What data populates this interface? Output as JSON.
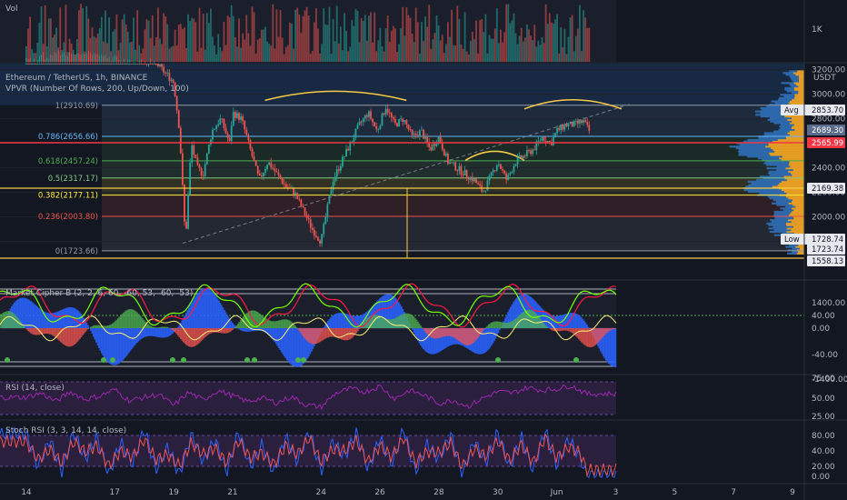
{
  "chart_data": {
    "type": "line",
    "panes": {
      "volume": {
        "title": "Vol",
        "tick": "1K"
      },
      "price": {
        "title": "Ethereum / TetherUS, 1h, BINANCE",
        "indicator": "VPVR (Number Of Rows, 200, Up/Down, 100)",
        "unit": "USDT",
        "ylim": [
          1500,
          3250
        ],
        "ticks": [
          "3200.00",
          "3000.00",
          "2800.00",
          "2600.00",
          "2400.00",
          "2200.00",
          "2000.00",
          "1800.00"
        ],
        "avg_label": "Avg",
        "avg_price": "2853.70",
        "low_label": "Low",
        "low_price": "1728.74",
        "current_prices": [
          "2689.30",
          "2565.99"
        ],
        "price_tags": [
          "2169.38",
          "1723.74",
          "1558.13"
        ],
        "fib_levels": [
          {
            "label": "1(2910.69)",
            "price": 2910.69,
            "color": "#9598a1"
          },
          {
            "label": "0.786(2656.66)",
            "price": 2656.66,
            "color": "#64b5f6"
          },
          {
            "label": "0.618(2457.24)",
            "price": 2457.24,
            "color": "#4caf50"
          },
          {
            "label": "0.5(2317.17)",
            "price": 2317.17,
            "color": "#81c784"
          },
          {
            "label": "0.382(2177.11)",
            "price": 2177.11,
            "color": "#ffeb3b"
          },
          {
            "label": "0.236(2003.80)",
            "price": 2003.8,
            "color": "#ef5350"
          },
          {
            "label": "0(1723.66)",
            "price": 1723.66,
            "color": "#9598a1"
          }
        ],
        "series": [
          {
            "name": "close",
            "x": [
              14,
              15,
              16,
              17,
              17.7,
              18.3,
              19,
              19.2,
              19.4,
              19.6,
              19.8,
              20,
              20.3,
              20.6,
              20.9,
              21,
              21.3,
              21.6,
              21.9,
              22.2,
              22.5,
              22.8,
              23.1,
              23.4,
              23.7,
              24,
              24.2,
              24.4,
              24.7,
              25,
              25.3,
              25.6,
              25.9,
              26.2,
              26.5,
              26.8,
              27.1,
              27.4,
              27.7,
              28,
              28.3,
              28.6,
              28.9,
              29.2,
              29.5,
              29.8,
              30,
              30.3,
              30.6,
              30.9,
              31.2,
              31.5,
              31.8,
              32,
              32.3,
              32.6,
              32.9,
              33.1
            ],
            "y": [
              3300,
              3350,
              3380,
              3320,
              3300,
              3280,
              3100,
              2700,
              1800,
              2600,
              2400,
              2350,
              2700,
              2800,
              2600,
              2850,
              2800,
              2550,
              2300,
              2450,
              2350,
              2250,
              2200,
              2050,
              1900,
              1800,
              2050,
              2300,
              2450,
              2600,
              2750,
              2850,
              2700,
              2900,
              2750,
              2800,
              2650,
              2700,
              2550,
              2650,
              2450,
              2400,
              2350,
              2300,
              2200,
              2350,
              2450,
              2300,
              2450,
              2500,
              2550,
              2650,
              2600,
              2700,
              2750,
              2750,
              2780,
              2700
            ]
          }
        ],
        "trendline": {
          "x": [
            19.3,
            34.5
          ],
          "y": [
            1785,
            2920
          ]
        }
      },
      "market_cipher": {
        "title": "Market Cipher B (2, 2, 6, 60, -60, 53, -60, -53)",
        "ylim": [
          -75,
          75
        ],
        "ticks": [
          "1400.00",
          "40.00",
          "0.00",
          "-40.00",
          "-1400.00"
        ]
      },
      "rsi": {
        "title": "RSI (14, close)",
        "ylim": [
          20,
          80
        ],
        "ticks": [
          "75.00",
          "50.00",
          "25.00"
        ],
        "x": [
          14,
          14.5,
          15,
          15.5,
          16,
          16.5,
          17,
          17.5,
          18,
          18.5,
          19,
          19.5,
          20,
          20.5,
          21,
          21.5,
          22,
          22.5,
          23,
          23.5,
          24,
          24.5,
          25,
          25.5,
          26,
          26.5,
          27,
          27.5,
          28,
          28.5,
          29,
          29.5,
          30,
          30.5,
          31,
          31.5,
          32,
          32.5,
          33
        ],
        "values": [
          50,
          56,
          44,
          58,
          47,
          52,
          61,
          45,
          50,
          54,
          38,
          57,
          46,
          60,
          52,
          44,
          49,
          42,
          51,
          39,
          36,
          56,
          62,
          58,
          66,
          48,
          60,
          53,
          41,
          46,
          37,
          49,
          58,
          56,
          64,
          60,
          62,
          67,
          55
        ]
      },
      "stoch_rsi": {
        "title": "Stoch RSI (3, 3, 14, 14, close)",
        "ylim": [
          -5,
          105
        ],
        "ticks": [
          "80.00",
          "40.00",
          "20.00",
          "0.00"
        ],
        "series": [
          {
            "name": "K",
            "x": [
              14,
              14.4,
              14.8,
              15.2,
              15.6,
              16,
              16.4,
              16.8,
              17.2,
              17.6,
              18,
              18.4,
              18.8,
              19.2,
              19.6,
              20,
              20.4,
              20.8,
              21.2,
              21.6,
              22,
              22.4,
              22.8,
              23.2,
              23.6,
              24,
              24.4,
              24.8,
              25.2,
              25.6,
              26,
              26.4,
              26.8,
              27.2,
              27.6,
              28,
              28.4,
              28.8,
              29.2,
              29.6,
              30,
              30.4,
              30.8,
              31.2,
              31.6,
              32,
              32.4,
              32.8,
              33
            ],
            "values": [
              85,
              20,
              75,
              10,
              90,
              35,
              80,
              5,
              70,
              25,
              95,
              15,
              60,
              5,
              85,
              30,
              75,
              10,
              90,
              20,
              65,
              8,
              80,
              30,
              92,
              12,
              70,
              40,
              88,
              15,
              78,
              25,
              95,
              10,
              65,
              35,
              85,
              5,
              72,
              28,
              90,
              18,
              80,
              12,
              94,
              22,
              76,
              38,
              5
            ]
          },
          {
            "name": "D",
            "x": [
              14,
              14.4,
              14.8,
              15.2,
              15.6,
              16,
              16.4,
              16.8,
              17.2,
              17.6,
              18,
              18.4,
              18.8,
              19.2,
              19.6,
              20,
              20.4,
              20.8,
              21.2,
              21.6,
              22,
              22.4,
              22.8,
              23.2,
              23.6,
              24,
              24.4,
              24.8,
              25.2,
              25.6,
              26,
              26.4,
              26.8,
              27.2,
              27.6,
              28,
              28.4,
              28.8,
              29.2,
              29.6,
              30,
              30.4,
              30.8,
              31.2,
              31.6,
              32,
              32.4,
              32.8,
              33
            ],
            "values": [
              70,
              35,
              55,
              28,
              70,
              50,
              62,
              22,
              52,
              40,
              75,
              35,
              45,
              22,
              68,
              45,
              58,
              28,
              72,
              38,
              48,
              25,
              62,
              45,
              78,
              30,
              55,
              52,
              72,
              30,
              62,
              40,
              78,
              28,
              50,
              48,
              68,
              20,
              56,
              42,
              72,
              32,
              65,
              28,
              78,
              38,
              60,
              48,
              15
            ]
          }
        ]
      }
    },
    "x_axis": {
      "ticks": [
        "14",
        "17",
        "19",
        "21",
        "24",
        "26",
        "28",
        "30",
        "Jun",
        "3",
        "5",
        "7",
        "9"
      ],
      "positions": [
        14,
        17,
        19,
        21,
        24,
        26,
        28,
        30,
        32,
        34,
        36,
        38,
        40
      ],
      "xlim": [
        13.2,
        40.4
      ]
    },
    "colors": {
      "background": "#131722",
      "grid": "#1e222d",
      "up": "#26a69a",
      "down": "#ef5350",
      "blue_wave": "#2962ff",
      "rsi": "#9c27b0",
      "stoch_k": "#2962ff",
      "stoch_d": "#ef5350",
      "vp_up": "#2f6eb5",
      "vp_down": "#f5a623",
      "red_level": "#f23645",
      "yellow_level": "#f7c948"
    }
  }
}
